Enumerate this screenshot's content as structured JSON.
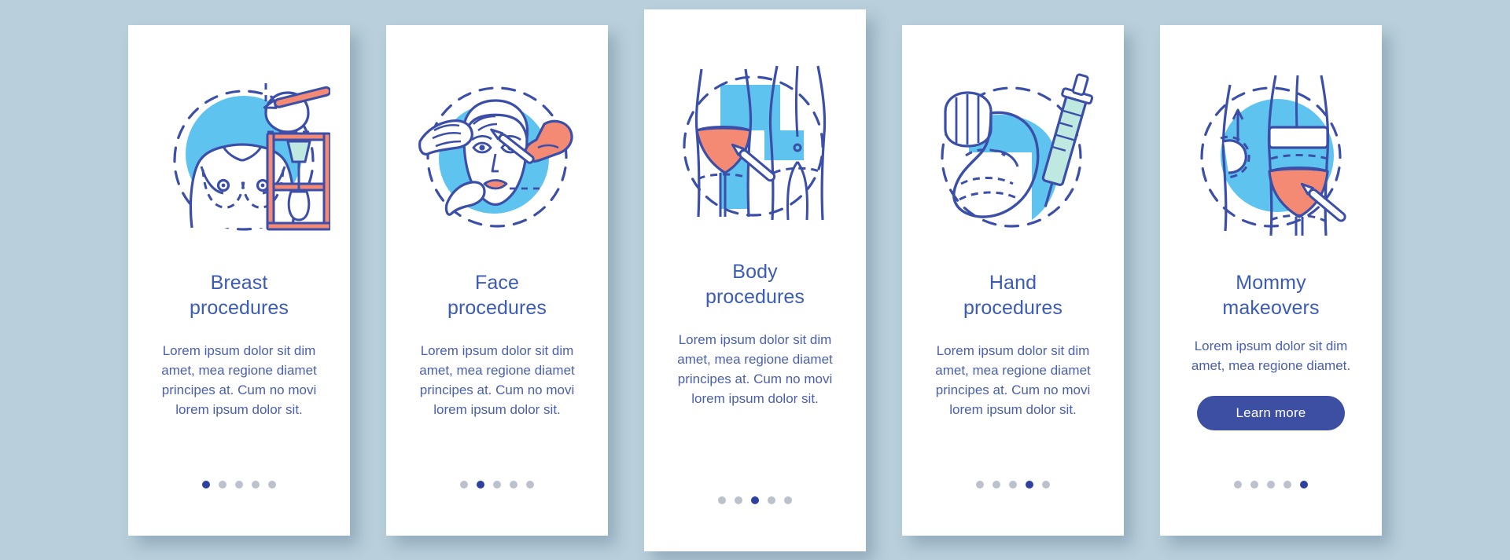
{
  "theme": {
    "background": "#b9cfdb",
    "card_background": "#ffffff",
    "title_color": "#3b5bb5",
    "body_color": "#4a5fae",
    "accent_blue": "#2f41a0",
    "illustration_blue": "#5ec3ef",
    "illustration_line": "#3b4fa8",
    "illustration_coral": "#f58a74",
    "illustration_mint": "#bfe9e0",
    "dot_inactive": "#bcc2cd",
    "dot_active": "#2f41a0",
    "button_background": "#3c4fa3",
    "button_text": "#ffffff"
  },
  "screens": [
    {
      "id": "breast-procedures",
      "icon": "breast-procedure-illustration",
      "title_line1": "Breast",
      "title_line2": "procedures",
      "body": "Lorem ipsum dolor sit dim amet, mea regione diamet principes at. Cum no movi lorem ipsum dolor sit.",
      "dots": {
        "total": 5,
        "active_index": 0
      },
      "cta": null
    },
    {
      "id": "face-procedures",
      "icon": "face-procedure-illustration",
      "title_line1": "Face",
      "title_line2": "procedures",
      "body": "Lorem ipsum dolor sit dim amet, mea regione diamet principes at. Cum no movi lorem ipsum dolor sit.",
      "dots": {
        "total": 5,
        "active_index": 1
      },
      "cta": null
    },
    {
      "id": "body-procedures",
      "icon": "body-procedure-illustration",
      "title_line1": "Body",
      "title_line2": "procedures",
      "body": "Lorem ipsum dolor sit dim amet, mea regione diamet principes at. Cum no movi lorem ipsum dolor sit.",
      "dots": {
        "total": 5,
        "active_index": 2
      },
      "cta": null
    },
    {
      "id": "hand-procedures",
      "icon": "hand-procedure-illustration",
      "title_line1": "Hand",
      "title_line2": "procedures",
      "body": "Lorem ipsum dolor sit dim amet, mea regione diamet principes at. Cum no movi lorem ipsum dolor sit.",
      "dots": {
        "total": 5,
        "active_index": 3
      },
      "cta": null
    },
    {
      "id": "mommy-makeovers",
      "icon": "mommy-makeover-illustration",
      "title_line1": "Mommy",
      "title_line2": "makeovers",
      "body": "Lorem ipsum dolor sit dim amet, mea regione diamet.",
      "dots": {
        "total": 5,
        "active_index": 4
      },
      "cta": "Learn more"
    }
  ]
}
